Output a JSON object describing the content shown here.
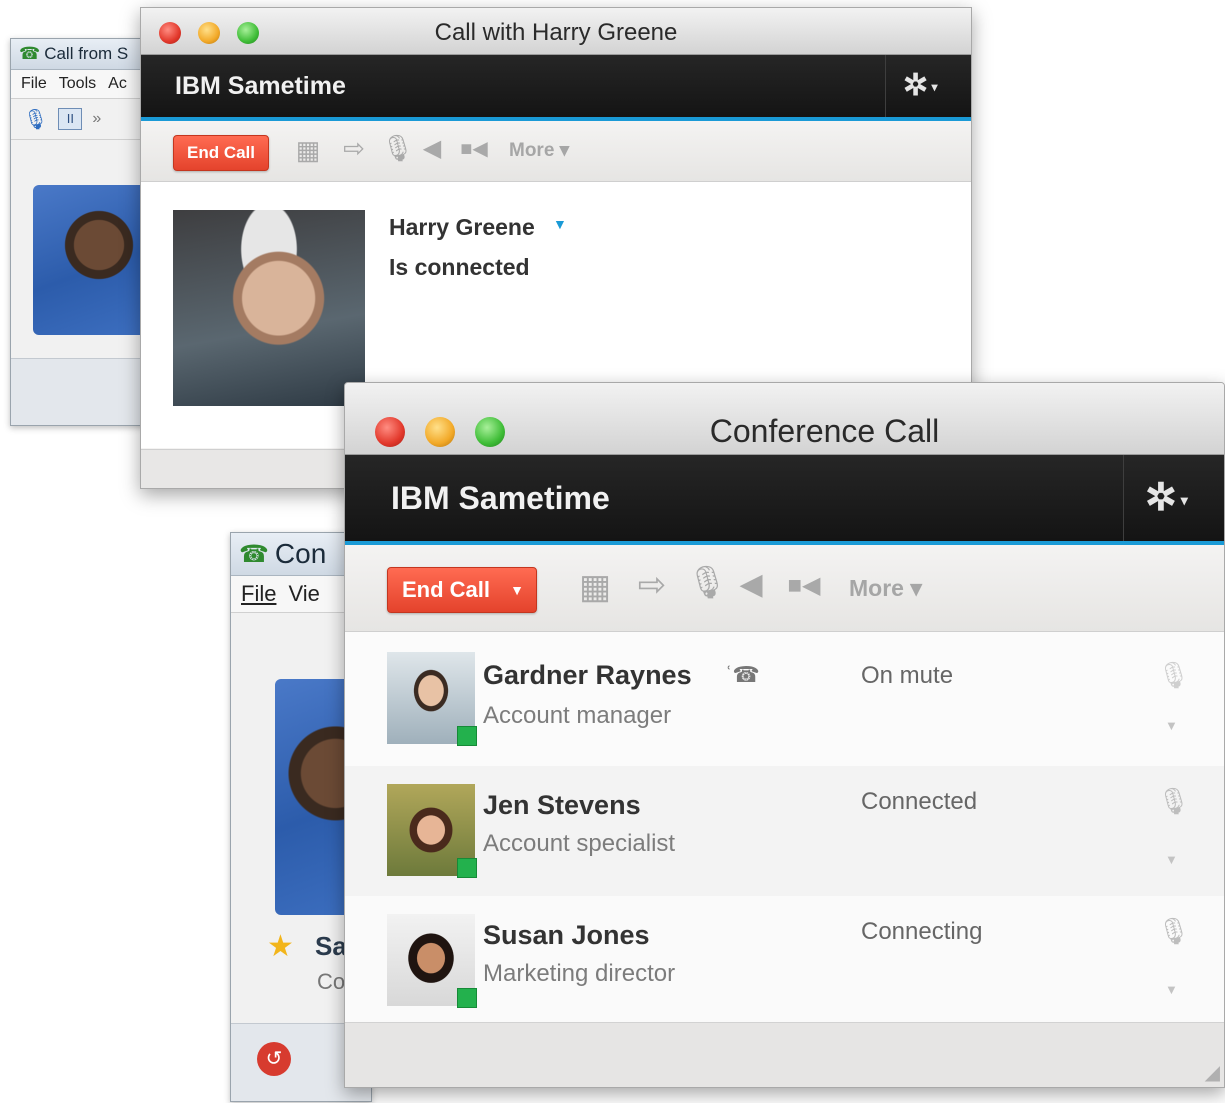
{
  "back_window_1": {
    "title": "Call from S",
    "menu": [
      "File",
      "Tools",
      "Ac"
    ]
  },
  "back_window_2": {
    "title": "Con",
    "menu": [
      "File",
      "Vie"
    ],
    "contact_initial": "Sa",
    "contact_sub": "Co"
  },
  "call_window": {
    "title": "Call with Harry Greene",
    "banner": "IBM Sametime",
    "gear": "✲",
    "end_call": "End Call",
    "more": "More ▾",
    "contact_name": "Harry Greene",
    "contact_status": "Is connected"
  },
  "conference_window": {
    "title": "Conference Call",
    "banner": "IBM Sametime",
    "gear": "✲",
    "end_call": "End Call",
    "more": "More ▾",
    "participants": [
      {
        "name": "Gardner Raynes",
        "role": "Account manager",
        "status": "On mute",
        "speaking_icon": "speaker-phone-icon",
        "mic": "mic-muted-icon"
      },
      {
        "name": "Jen Stevens",
        "role": "Account specialist",
        "status": "Connected",
        "mic": "mic-icon"
      },
      {
        "name": "Susan Jones",
        "role": "Marketing director",
        "status": "Connecting",
        "mic": "mic-icon"
      }
    ]
  },
  "colors": {
    "banner_bg": "#1b1b1b",
    "banner_accent": "#1a9ad6",
    "end_call_red": "#e94b33",
    "presence_green": "#23b14d"
  }
}
